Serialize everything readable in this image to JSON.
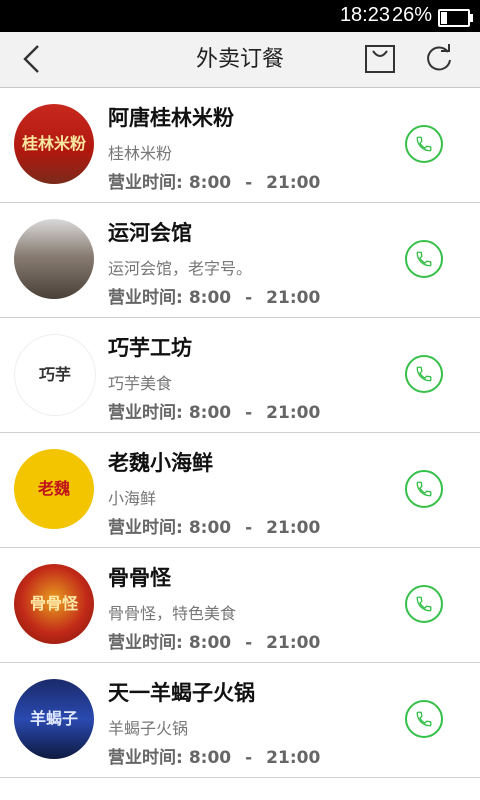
{
  "status_bar": {
    "time": "18:23",
    "battery_text": "26%",
    "battery_level": 0.26
  },
  "header": {
    "title": "外卖订餐",
    "back_icon": "back-arrow-icon",
    "cart_icon": "shopping-bag-icon",
    "refresh_icon": "refresh-icon"
  },
  "hours_label": "营业时间:",
  "hours_sep": "-",
  "accent_color": "#36c04a",
  "restaurants": [
    {
      "name": "阿唐桂林米粉",
      "desc": "桂林米粉",
      "open": "8:00",
      "close": "21:00",
      "avatar_text": "桂林米粉"
    },
    {
      "name": "运河会馆",
      "desc": "运河会馆，老字号。",
      "open": "8:00",
      "close": "21:00",
      "avatar_text": ""
    },
    {
      "name": "巧芋工坊",
      "desc": "巧芋美食",
      "open": "8:00",
      "close": "21:00",
      "avatar_text": "巧芋"
    },
    {
      "name": "老魏小海鲜",
      "desc": "小海鲜",
      "open": "8:00",
      "close": "21:00",
      "avatar_text": "老魏"
    },
    {
      "name": "骨骨怪",
      "desc": "骨骨怪，特色美食",
      "open": "8:00",
      "close": "21:00",
      "avatar_text": "骨骨怪"
    },
    {
      "name": "天一羊蝎子火锅",
      "desc": "羊蝎子火锅",
      "open": "8:00",
      "close": "21:00",
      "avatar_text": "羊蝎子"
    }
  ]
}
